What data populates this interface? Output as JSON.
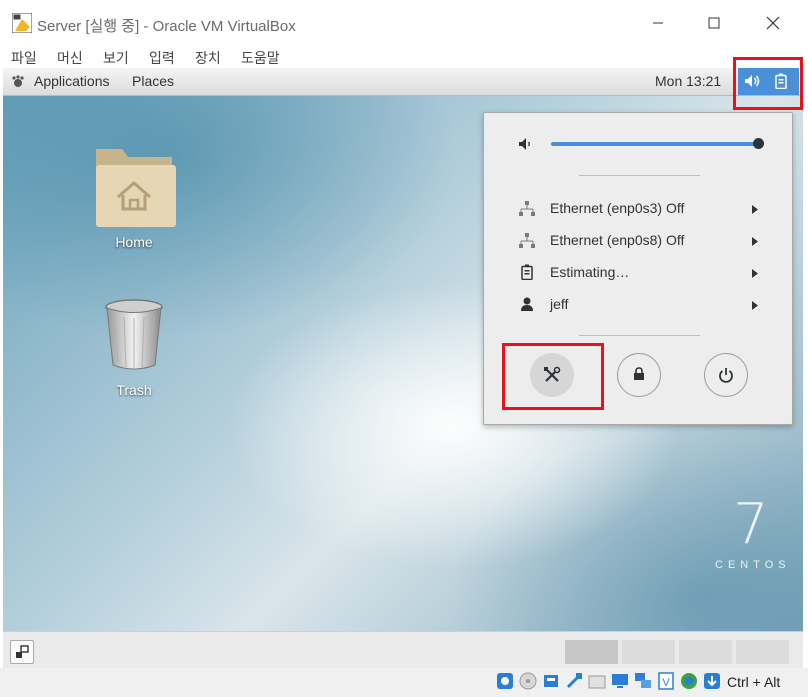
{
  "window": {
    "title": "Server [실행 중] - Oracle VM VirtualBox",
    "menu": [
      "파일",
      "머신",
      "보기",
      "입력",
      "장치",
      "도움말"
    ]
  },
  "gnome_topbar": {
    "applications_label": "Applications",
    "places_label": "Places",
    "clock": "Mon 13:21"
  },
  "desktop": {
    "icons": [
      {
        "label": "Home",
        "icon": "home-folder-icon"
      },
      {
        "label": "Trash",
        "icon": "trash-icon"
      }
    ],
    "watermark_number": "7",
    "watermark_text": "CENTOS"
  },
  "system_menu": {
    "volume_level": 1.0,
    "items": [
      {
        "label": "Ethernet (enp0s3) Off",
        "icon": "network-wired-icon"
      },
      {
        "label": "Ethernet (enp0s8) Off",
        "icon": "network-wired-icon"
      },
      {
        "label": "Estimating…",
        "icon": "battery-icon"
      },
      {
        "label": "jeff",
        "icon": "user-icon"
      }
    ],
    "buttons": [
      "settings-icon",
      "lock-icon",
      "power-icon"
    ]
  },
  "statusbar": {
    "host_key": "Ctrl + Alt"
  },
  "colors": {
    "highlight_red": "#e8121e",
    "topbar_active_blue": "#4a90d9",
    "slider_blue": "#4a90d9"
  }
}
